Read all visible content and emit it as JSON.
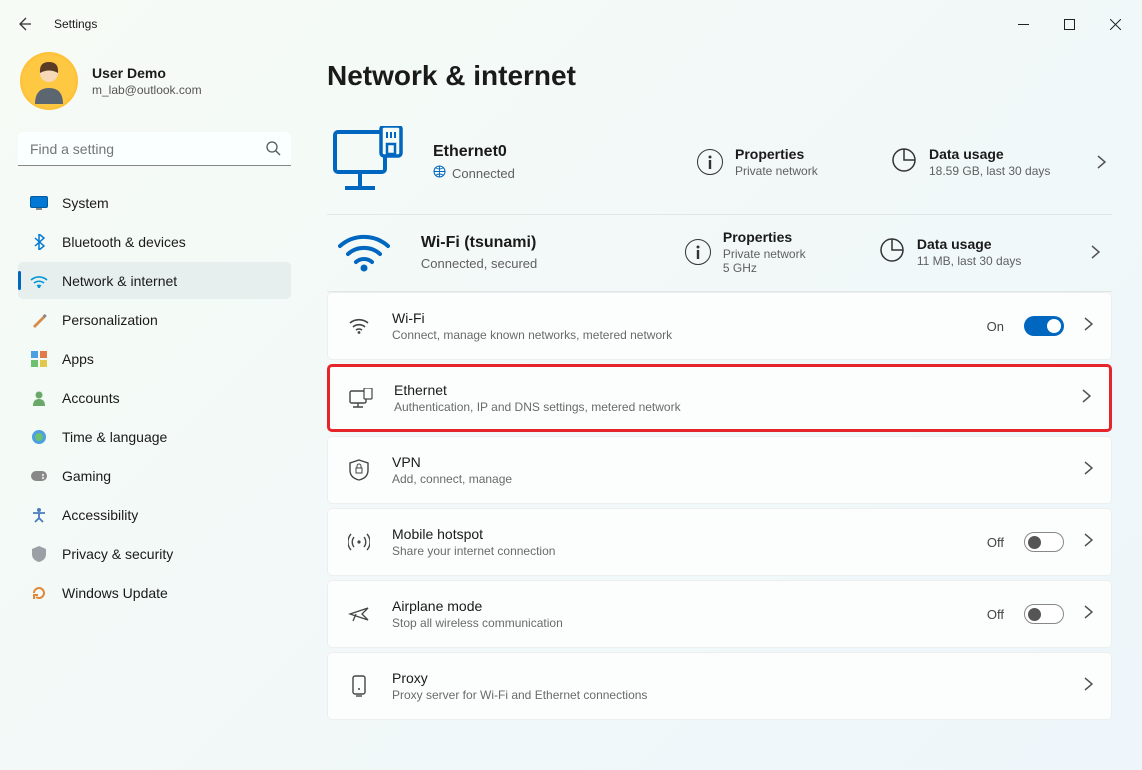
{
  "window": {
    "title": "Settings"
  },
  "user": {
    "name": "User Demo",
    "email": "m_lab@outlook.com"
  },
  "search": {
    "placeholder": "Find a setting"
  },
  "nav": [
    {
      "label": "System",
      "icon": "system"
    },
    {
      "label": "Bluetooth & devices",
      "icon": "bluetooth"
    },
    {
      "label": "Network & internet",
      "icon": "network",
      "active": true
    },
    {
      "label": "Personalization",
      "icon": "personalization"
    },
    {
      "label": "Apps",
      "icon": "apps"
    },
    {
      "label": "Accounts",
      "icon": "accounts"
    },
    {
      "label": "Time & language",
      "icon": "time"
    },
    {
      "label": "Gaming",
      "icon": "gaming"
    },
    {
      "label": "Accessibility",
      "icon": "accessibility"
    },
    {
      "label": "Privacy & security",
      "icon": "privacy"
    },
    {
      "label": "Windows Update",
      "icon": "update"
    }
  ],
  "page": {
    "title": "Network & internet"
  },
  "connections": [
    {
      "name": "Ethernet0",
      "status": "Connected",
      "icon": "ethernet-large",
      "properties": {
        "label": "Properties",
        "sub": "Private network"
      },
      "usage": {
        "label": "Data usage",
        "sub": "18.59 GB, last 30 days"
      }
    },
    {
      "name": "Wi-Fi (tsunami)",
      "status": "Connected, secured",
      "icon": "wifi-large",
      "properties": {
        "label": "Properties",
        "sub": "Private network\n5 GHz"
      },
      "usage": {
        "label": "Data usage",
        "sub": "11 MB, last 30 days"
      }
    }
  ],
  "cards": {
    "wifi": {
      "title": "Wi-Fi",
      "sub": "Connect, manage known networks, metered network",
      "state": "On",
      "toggle": "on"
    },
    "ethernet": {
      "title": "Ethernet",
      "sub": "Authentication, IP and DNS settings, metered network"
    },
    "vpn": {
      "title": "VPN",
      "sub": "Add, connect, manage"
    },
    "hotspot": {
      "title": "Mobile hotspot",
      "sub": "Share your internet connection",
      "state": "Off",
      "toggle": "off"
    },
    "airplane": {
      "title": "Airplane mode",
      "sub": "Stop all wireless communication",
      "state": "Off",
      "toggle": "off"
    },
    "proxy": {
      "title": "Proxy",
      "sub": "Proxy server for Wi-Fi and Ethernet connections"
    }
  }
}
